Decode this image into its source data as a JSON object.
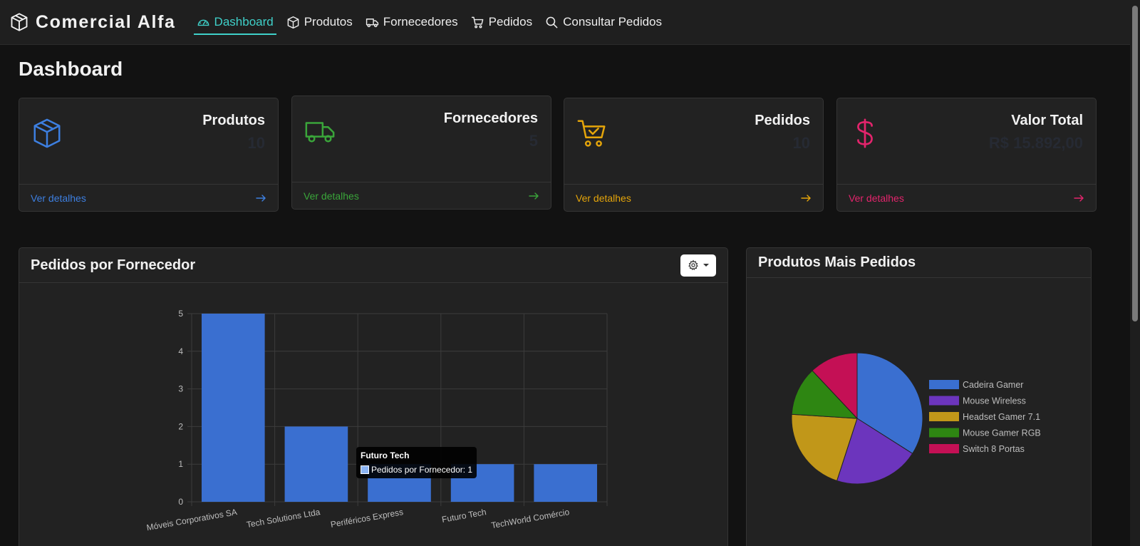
{
  "brand": {
    "name": "Comercial Alfa",
    "icon": "box-icon"
  },
  "nav": {
    "items": [
      {
        "label": "Dashboard",
        "icon": "speedometer-icon",
        "active": true
      },
      {
        "label": "Produtos",
        "icon": "box-icon",
        "active": false
      },
      {
        "label": "Fornecedores",
        "icon": "truck-icon",
        "active": false
      },
      {
        "label": "Pedidos",
        "icon": "cart-icon",
        "active": false
      },
      {
        "label": "Consultar Pedidos",
        "icon": "search-icon",
        "active": false
      }
    ]
  },
  "page": {
    "title": "Dashboard"
  },
  "cards": [
    {
      "title": "Produtos",
      "value": "10",
      "link": "Ver detalhes",
      "color": "#3d7fe0",
      "icon": "box-icon"
    },
    {
      "title": "Fornecedores",
      "value": "5",
      "link": "Ver detalhes",
      "color": "#3aa53a",
      "icon": "truck-icon"
    },
    {
      "title": "Pedidos",
      "value": "10",
      "link": "Ver detalhes",
      "color": "#e5a50a",
      "icon": "cart-check-icon"
    },
    {
      "title": "Valor Total",
      "value": "R$ 15.892,00",
      "link": "Ver detalhes",
      "color": "#e3246c",
      "icon": "dollar-icon"
    }
  ],
  "bar_panel": {
    "title": "Pedidos por Fornecedor",
    "settings_icon": "gear-icon"
  },
  "pie_panel": {
    "title": "Produtos Mais Pedidos"
  },
  "tooltip": {
    "title": "Futuro Tech",
    "text": "Pedidos por Fornecedor: 1"
  },
  "colors": {
    "accent": "#3fd0c9",
    "bar": "#3a6fd0"
  },
  "chart_data": [
    {
      "type": "bar",
      "categories": [
        "Móveis Corporativos SA",
        "Tech Solutions Ltda",
        "Periféricos Express",
        "Futuro Tech",
        "TechWorld Comércio"
      ],
      "series": [
        {
          "name": "Pedidos por Fornecedor",
          "values": [
            5,
            2,
            1,
            1,
            1
          ]
        }
      ],
      "ylim": [
        0,
        5
      ],
      "yticks": [
        "0",
        "1",
        "2",
        "3",
        "4",
        "5"
      ],
      "grid": true
    },
    {
      "type": "pie",
      "labels": [
        "Cadeira Gamer",
        "Mouse Wireless",
        "Headset Gamer 7.1",
        "Mouse Gamer RGB",
        "Switch 8 Portas"
      ],
      "values": [
        34,
        21,
        21,
        12,
        12
      ],
      "colors": [
        "#3a6fd0",
        "#6c35bd",
        "#c19719",
        "#2e8612",
        "#c41055"
      ],
      "legend": "right"
    }
  ]
}
